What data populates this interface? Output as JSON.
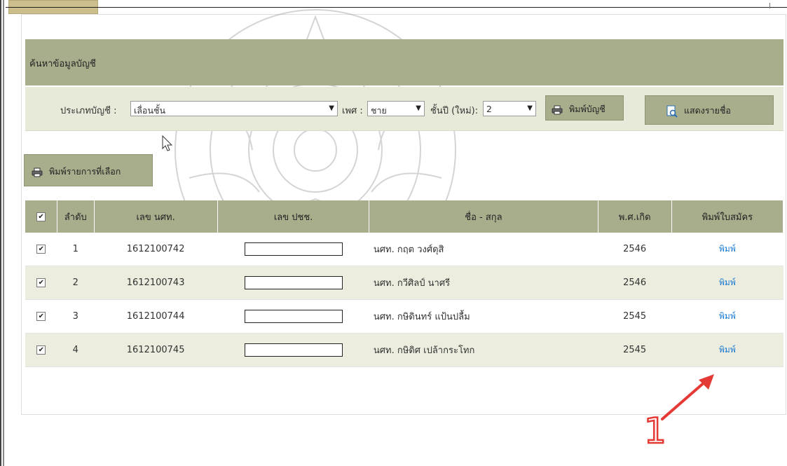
{
  "search": {
    "title": "ค้นหาข้อมูลบัญชี",
    "account_type_label": "ประเภทบัญชี :",
    "account_type_value": "เลื่อนชั้น",
    "gender_label": "เพศ :",
    "gender_value": "ชาย",
    "year_label": "ชั้นปี (ใหม่):",
    "year_value": "2",
    "print_account_button": "พิมพ์บัญชี",
    "show_names_button": "แสดงรายชื่อ"
  },
  "actions": {
    "print_selected_button": "พิมพ์รายการที่เลือก"
  },
  "table": {
    "headers": {
      "check": "✔",
      "order": "ลำดับ",
      "student_no": "เลข นศท.",
      "id_no": "เลข ปชช.",
      "name": "ชื่อ - สกุล",
      "birth_year": "พ.ศ.เกิด",
      "print_form": "พิมพ์ใบสมัคร"
    },
    "rows": [
      {
        "checked": "✔",
        "order": "1",
        "student_no": "1612100742",
        "name": "นศท. กฤต  วงศ์ดุสิ",
        "birth_year": "2546",
        "print": "พิมพ์"
      },
      {
        "checked": "✔",
        "order": "2",
        "student_no": "1612100743",
        "name": "นศท. กวีศิลป์  นาศรี",
        "birth_year": "2546",
        "print": "พิมพ์"
      },
      {
        "checked": "✔",
        "order": "3",
        "student_no": "1612100744",
        "name": "นศท. กษิดินทร์  แป้นปลื้ม",
        "birth_year": "2545",
        "print": "พิมพ์"
      },
      {
        "checked": "✔",
        "order": "4",
        "student_no": "1612100745",
        "name": "นศท. กษิดิศ  เปล้ากระโทก",
        "birth_year": "2545",
        "print": "พิมพ์"
      }
    ]
  },
  "annotation": {
    "number": "1",
    "color": "#e53935"
  },
  "colors": {
    "header_olive": "#a8ad8c",
    "bar_light": "#e8ead9",
    "row_alt": "#ecedde",
    "link_blue": "#1a7ad2"
  }
}
